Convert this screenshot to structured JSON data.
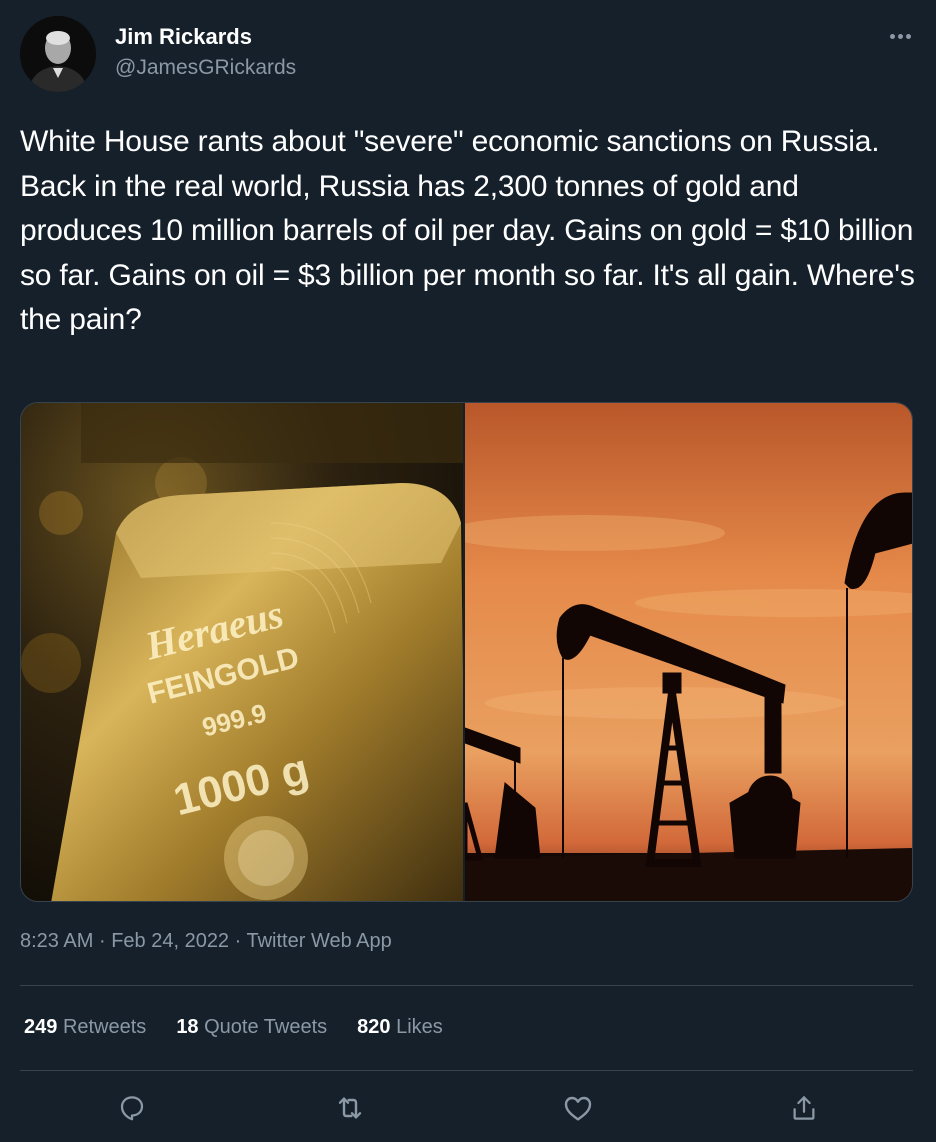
{
  "author": {
    "display_name": "Jim Rickards",
    "handle": "@JamesGRickards"
  },
  "tweet": {
    "text": "White House rants about \"severe\" economic sanctions on Russia. Back in the real world, Russia has 2,300 tonnes of gold and produces 10 million barrels of oil per day. Gains on gold = $10 billion so far. Gains on oil = $3 billion per month so far. It's all gain. Where's the pain?",
    "time": "8:23 AM",
    "date": "Feb 24, 2022",
    "source": "Twitter Web App",
    "separator": "·"
  },
  "media": {
    "gold_bar": {
      "brand_line1": "Heraeus",
      "brand_line2": "FEINGOLD",
      "purity": "999.9",
      "weight": "1000 g"
    }
  },
  "stats": {
    "retweets_count": "249",
    "retweets_label": "Retweets",
    "quotes_count": "18",
    "quotes_label": "Quote Tweets",
    "likes_count": "820",
    "likes_label": "Likes"
  },
  "icons": {
    "reply": "reply-icon",
    "retweet": "retweet-icon",
    "like": "like-icon",
    "share": "share-icon",
    "more": "more-icon"
  },
  "colors": {
    "background": "#15202b",
    "text_primary": "#ffffff",
    "text_secondary": "#8b98a5",
    "divider": "#38444d"
  }
}
